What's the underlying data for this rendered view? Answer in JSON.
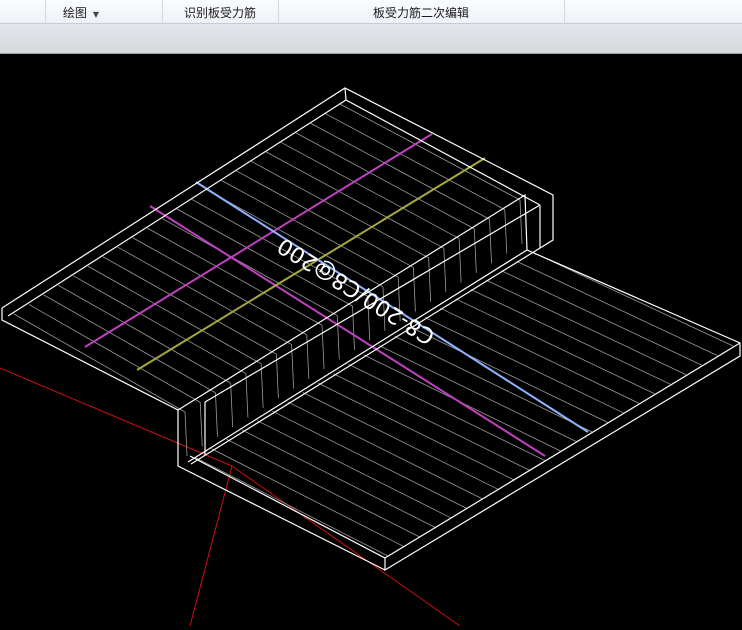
{
  "toolbar": {
    "draw_label": "绘图",
    "identify_label": "识别板受力筋",
    "edit_label": "板受力筋二次编辑"
  },
  "viewport": {
    "rebar_label": "C8-200/C8@200",
    "colors": {
      "background": "#000000",
      "edge": "#ffffff",
      "rebar": "#9a9a9a",
      "magenta": "#c040c0",
      "yellow": "#a8a83a",
      "blue": "#8fb3ff",
      "axis": "#cc1111"
    }
  }
}
